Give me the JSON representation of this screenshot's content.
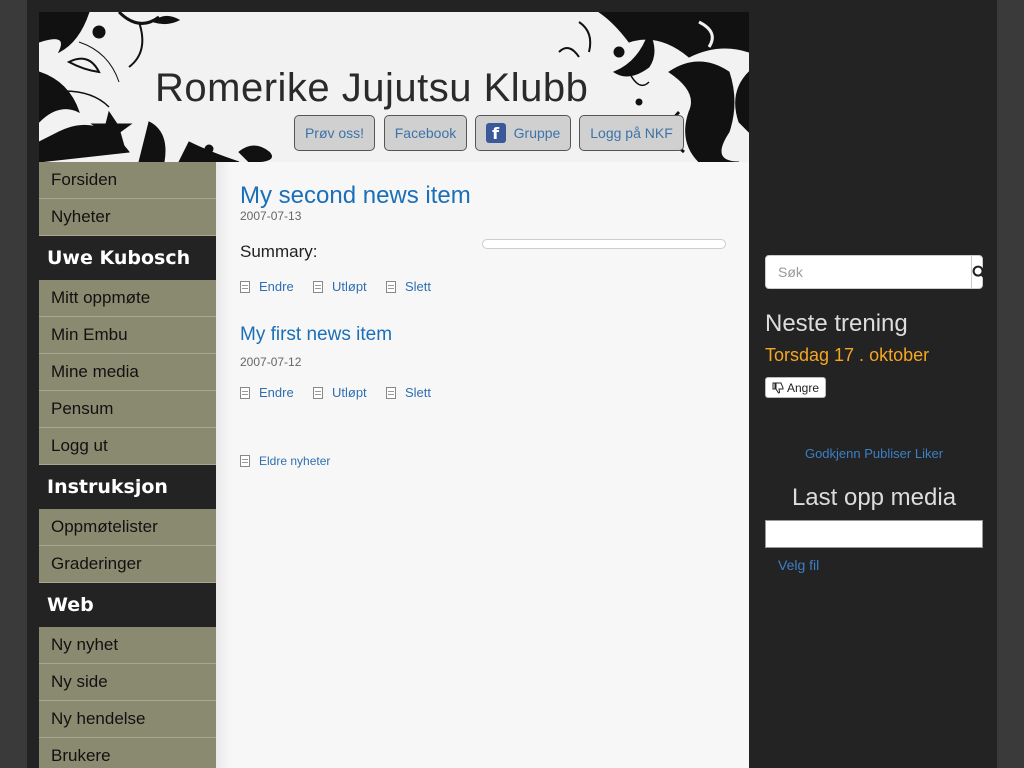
{
  "header": {
    "site_title": "Romerike Jujutsu Klubb",
    "buttons": [
      {
        "label": "Prøv oss!"
      },
      {
        "label": "Facebook"
      },
      {
        "label": "Gruppe",
        "icon": "facebook-icon",
        "icon_glyph": "f"
      },
      {
        "label": "Logg på NKF"
      }
    ]
  },
  "sidebar": {
    "top": [
      {
        "label": "Forsiden"
      },
      {
        "label": "Nyheter"
      }
    ],
    "sections": [
      {
        "heading": "Uwe Kubosch",
        "items": [
          "Mitt oppmøte",
          "Min Embu",
          "Mine media",
          "Pensum",
          "Logg ut"
        ]
      },
      {
        "heading": "Instruksjon",
        "items": [
          "Oppmøtelister",
          "Graderinger"
        ]
      },
      {
        "heading": "Web",
        "items": [
          "Ny nyhet",
          "Ny side",
          "Ny hendelse",
          "Brukere"
        ]
      }
    ]
  },
  "main": {
    "news": [
      {
        "title": "My second news item",
        "date": "2007-07-13",
        "summary_label": "Summary:",
        "actions": [
          "Endre",
          "Utløpt",
          "Slett"
        ]
      },
      {
        "title": "My first news item",
        "date": "2007-07-12",
        "actions": [
          "Endre",
          "Utløpt",
          "Slett"
        ]
      }
    ],
    "older_link": "Eldre nyheter"
  },
  "right": {
    "search": {
      "placeholder": "Søk",
      "icon": "search-icon"
    },
    "next_training": {
      "title": "Neste trening",
      "date": "Torsdag 17 . oktober",
      "undo_label": "Angre",
      "undo_icon": "thumbs-down-icon"
    },
    "links": [
      "Godkjenn",
      "Publiser",
      "Liker"
    ],
    "upload": {
      "title": "Last opp media",
      "choose_label": "Velg fil"
    }
  },
  "colors": {
    "accent_link": "#1a6fb8",
    "sidebar_item": "#8a8a70",
    "dark_bg": "#232323",
    "date_orange": "#f5a623"
  }
}
